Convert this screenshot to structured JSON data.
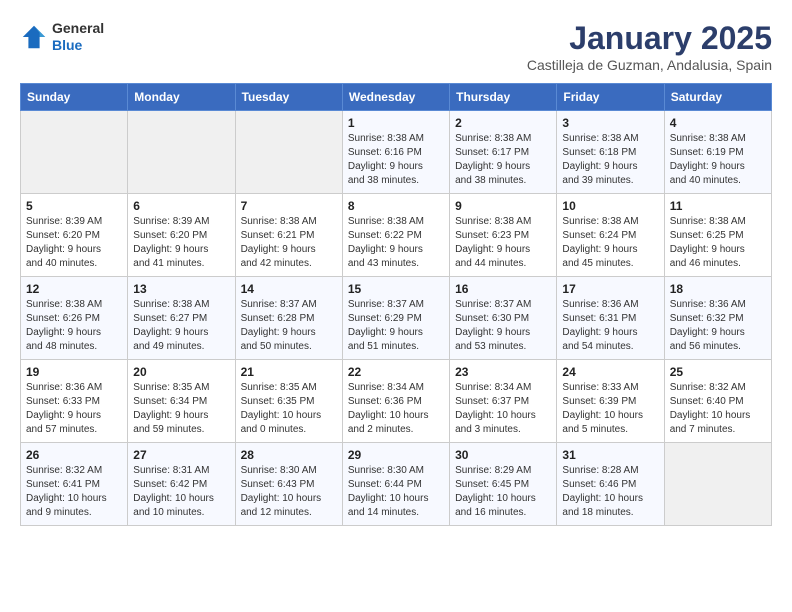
{
  "header": {
    "logo_general": "General",
    "logo_blue": "Blue",
    "month": "January 2025",
    "location": "Castilleja de Guzman, Andalusia, Spain"
  },
  "weekdays": [
    "Sunday",
    "Monday",
    "Tuesday",
    "Wednesday",
    "Thursday",
    "Friday",
    "Saturday"
  ],
  "weeks": [
    [
      {
        "day": "",
        "content": ""
      },
      {
        "day": "",
        "content": ""
      },
      {
        "day": "",
        "content": ""
      },
      {
        "day": "1",
        "content": "Sunrise: 8:38 AM\nSunset: 6:16 PM\nDaylight: 9 hours\nand 38 minutes."
      },
      {
        "day": "2",
        "content": "Sunrise: 8:38 AM\nSunset: 6:17 PM\nDaylight: 9 hours\nand 38 minutes."
      },
      {
        "day": "3",
        "content": "Sunrise: 8:38 AM\nSunset: 6:18 PM\nDaylight: 9 hours\nand 39 minutes."
      },
      {
        "day": "4",
        "content": "Sunrise: 8:38 AM\nSunset: 6:19 PM\nDaylight: 9 hours\nand 40 minutes."
      }
    ],
    [
      {
        "day": "5",
        "content": "Sunrise: 8:39 AM\nSunset: 6:20 PM\nDaylight: 9 hours\nand 40 minutes."
      },
      {
        "day": "6",
        "content": "Sunrise: 8:39 AM\nSunset: 6:20 PM\nDaylight: 9 hours\nand 41 minutes."
      },
      {
        "day": "7",
        "content": "Sunrise: 8:38 AM\nSunset: 6:21 PM\nDaylight: 9 hours\nand 42 minutes."
      },
      {
        "day": "8",
        "content": "Sunrise: 8:38 AM\nSunset: 6:22 PM\nDaylight: 9 hours\nand 43 minutes."
      },
      {
        "day": "9",
        "content": "Sunrise: 8:38 AM\nSunset: 6:23 PM\nDaylight: 9 hours\nand 44 minutes."
      },
      {
        "day": "10",
        "content": "Sunrise: 8:38 AM\nSunset: 6:24 PM\nDaylight: 9 hours\nand 45 minutes."
      },
      {
        "day": "11",
        "content": "Sunrise: 8:38 AM\nSunset: 6:25 PM\nDaylight: 9 hours\nand 46 minutes."
      }
    ],
    [
      {
        "day": "12",
        "content": "Sunrise: 8:38 AM\nSunset: 6:26 PM\nDaylight: 9 hours\nand 48 minutes."
      },
      {
        "day": "13",
        "content": "Sunrise: 8:38 AM\nSunset: 6:27 PM\nDaylight: 9 hours\nand 49 minutes."
      },
      {
        "day": "14",
        "content": "Sunrise: 8:37 AM\nSunset: 6:28 PM\nDaylight: 9 hours\nand 50 minutes."
      },
      {
        "day": "15",
        "content": "Sunrise: 8:37 AM\nSunset: 6:29 PM\nDaylight: 9 hours\nand 51 minutes."
      },
      {
        "day": "16",
        "content": "Sunrise: 8:37 AM\nSunset: 6:30 PM\nDaylight: 9 hours\nand 53 minutes."
      },
      {
        "day": "17",
        "content": "Sunrise: 8:36 AM\nSunset: 6:31 PM\nDaylight: 9 hours\nand 54 minutes."
      },
      {
        "day": "18",
        "content": "Sunrise: 8:36 AM\nSunset: 6:32 PM\nDaylight: 9 hours\nand 56 minutes."
      }
    ],
    [
      {
        "day": "19",
        "content": "Sunrise: 8:36 AM\nSunset: 6:33 PM\nDaylight: 9 hours\nand 57 minutes."
      },
      {
        "day": "20",
        "content": "Sunrise: 8:35 AM\nSunset: 6:34 PM\nDaylight: 9 hours\nand 59 minutes."
      },
      {
        "day": "21",
        "content": "Sunrise: 8:35 AM\nSunset: 6:35 PM\nDaylight: 10 hours\nand 0 minutes."
      },
      {
        "day": "22",
        "content": "Sunrise: 8:34 AM\nSunset: 6:36 PM\nDaylight: 10 hours\nand 2 minutes."
      },
      {
        "day": "23",
        "content": "Sunrise: 8:34 AM\nSunset: 6:37 PM\nDaylight: 10 hours\nand 3 minutes."
      },
      {
        "day": "24",
        "content": "Sunrise: 8:33 AM\nSunset: 6:39 PM\nDaylight: 10 hours\nand 5 minutes."
      },
      {
        "day": "25",
        "content": "Sunrise: 8:32 AM\nSunset: 6:40 PM\nDaylight: 10 hours\nand 7 minutes."
      }
    ],
    [
      {
        "day": "26",
        "content": "Sunrise: 8:32 AM\nSunset: 6:41 PM\nDaylight: 10 hours\nand 9 minutes."
      },
      {
        "day": "27",
        "content": "Sunrise: 8:31 AM\nSunset: 6:42 PM\nDaylight: 10 hours\nand 10 minutes."
      },
      {
        "day": "28",
        "content": "Sunrise: 8:30 AM\nSunset: 6:43 PM\nDaylight: 10 hours\nand 12 minutes."
      },
      {
        "day": "29",
        "content": "Sunrise: 8:30 AM\nSunset: 6:44 PM\nDaylight: 10 hours\nand 14 minutes."
      },
      {
        "day": "30",
        "content": "Sunrise: 8:29 AM\nSunset: 6:45 PM\nDaylight: 10 hours\nand 16 minutes."
      },
      {
        "day": "31",
        "content": "Sunrise: 8:28 AM\nSunset: 6:46 PM\nDaylight: 10 hours\nand 18 minutes."
      },
      {
        "day": "",
        "content": ""
      }
    ]
  ]
}
